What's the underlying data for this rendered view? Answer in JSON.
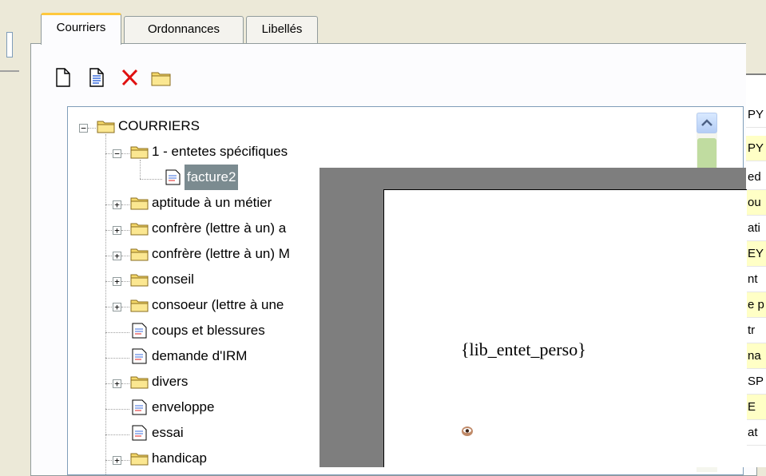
{
  "tabs": [
    {
      "label": "Courriers",
      "active": true
    },
    {
      "label": "Ordonnances",
      "active": false
    },
    {
      "label": "Libellés",
      "active": false
    }
  ],
  "toolbar": {
    "icons": [
      "new-document-icon",
      "edit-document-icon",
      "delete-icon",
      "new-folder-icon"
    ]
  },
  "tree": {
    "items": [
      {
        "label": "COURRIERS",
        "type": "folder",
        "expander": "−"
      },
      {
        "label": "1 - entetes spécifiques",
        "type": "folder",
        "expander": "−"
      },
      {
        "label": "facture2",
        "type": "document",
        "selected": true
      },
      {
        "label": "aptitude à un métier",
        "type": "folder",
        "expander": "+"
      },
      {
        "label": "confrère (lettre à un) a",
        "type": "folder",
        "expander": "+"
      },
      {
        "label": "confrère (lettre à un) M",
        "type": "folder",
        "expander": "+"
      },
      {
        "label": "conseil",
        "type": "folder",
        "expander": "+"
      },
      {
        "label": "consoeur (lettre à une",
        "type": "folder",
        "expander": "+"
      },
      {
        "label": "coups et blessures",
        "type": "document"
      },
      {
        "label": "demande d'IRM",
        "type": "document"
      },
      {
        "label": "divers",
        "type": "folder",
        "expander": "+"
      },
      {
        "label": "enveloppe",
        "type": "document"
      },
      {
        "label": "essai",
        "type": "document"
      },
      {
        "label": "handicap",
        "type": "folder",
        "expander": "+"
      }
    ]
  },
  "preview": {
    "placeholder_text": "{lib_entet_perso}"
  },
  "right_column": {
    "cells": [
      "PY",
      "PY",
      "ed",
      "ou",
      "ati",
      "EY",
      "nt",
      "e p",
      "tr",
      "na",
      "SP",
      "E",
      "at"
    ]
  },
  "colors": {
    "selection": "#7b8b90",
    "highlight_row": "#ffffc6",
    "active_tab_accent": "#ffc83c"
  }
}
